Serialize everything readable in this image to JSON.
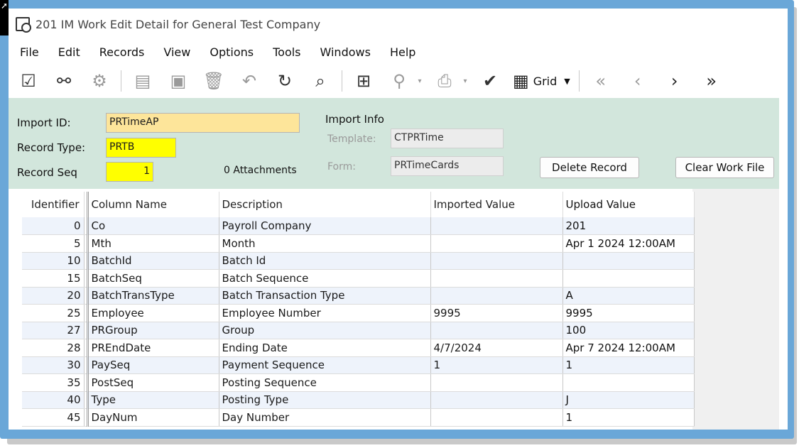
{
  "window": {
    "title": "201 IM Work Edit Detail for General Test Company"
  },
  "menu": [
    "File",
    "Edit",
    "Records",
    "View",
    "Options",
    "Tools",
    "Windows",
    "Help"
  ],
  "toolbar": {
    "grid_label": "Grid"
  },
  "header": {
    "import_id_label": "Import ID:",
    "import_id_value": "PRTimeAP",
    "record_type_label": "Record Type:",
    "record_type_value": "PRTB",
    "record_seq_label": "Record Seq",
    "record_seq_value": "1",
    "attachments": "0 Attachments",
    "import_info_label": "Import Info",
    "template_label": "Template:",
    "template_value": "CTPRTime",
    "form_label": "Form:",
    "form_value": "PRTimeCards",
    "delete_record": "Delete Record",
    "clear_work_file": "Clear Work File"
  },
  "grid": {
    "columns": [
      "Identifier",
      "Column Name",
      "Description",
      "Imported Value",
      "Upload Value"
    ],
    "rows": [
      {
        "id": "0",
        "col": "Co",
        "desc": "Payroll Company",
        "imp": "",
        "upl": "201"
      },
      {
        "id": "5",
        "col": "Mth",
        "desc": "Month",
        "imp": "",
        "upl": "Apr  1 2024 12:00AM"
      },
      {
        "id": "10",
        "col": "BatchId",
        "desc": "Batch Id",
        "imp": "",
        "upl": ""
      },
      {
        "id": "15",
        "col": "BatchSeq",
        "desc": "Batch Sequence",
        "imp": "",
        "upl": ""
      },
      {
        "id": "20",
        "col": "BatchTransType",
        "desc": "Batch Transaction Type",
        "imp": "",
        "upl": "A"
      },
      {
        "id": "25",
        "col": "Employee",
        "desc": "Employee Number",
        "imp": "9995",
        "upl": "9995"
      },
      {
        "id": "27",
        "col": "PRGroup",
        "desc": "Group",
        "imp": "",
        "upl": "100"
      },
      {
        "id": "28",
        "col": "PREndDate",
        "desc": "Ending Date",
        "imp": "4/7/2024",
        "upl": "Apr  7 2024 12:00AM"
      },
      {
        "id": "30",
        "col": "PaySeq",
        "desc": "Payment Sequence",
        "imp": "1",
        "upl": "1"
      },
      {
        "id": "35",
        "col": "PostSeq",
        "desc": "Posting Sequence",
        "imp": "",
        "upl": ""
      },
      {
        "id": "40",
        "col": "Type",
        "desc": "Posting Type",
        "imp": "",
        "upl": "J"
      },
      {
        "id": "45",
        "col": "DayNum",
        "desc": "Day Number",
        "imp": "",
        "upl": "1"
      }
    ]
  }
}
